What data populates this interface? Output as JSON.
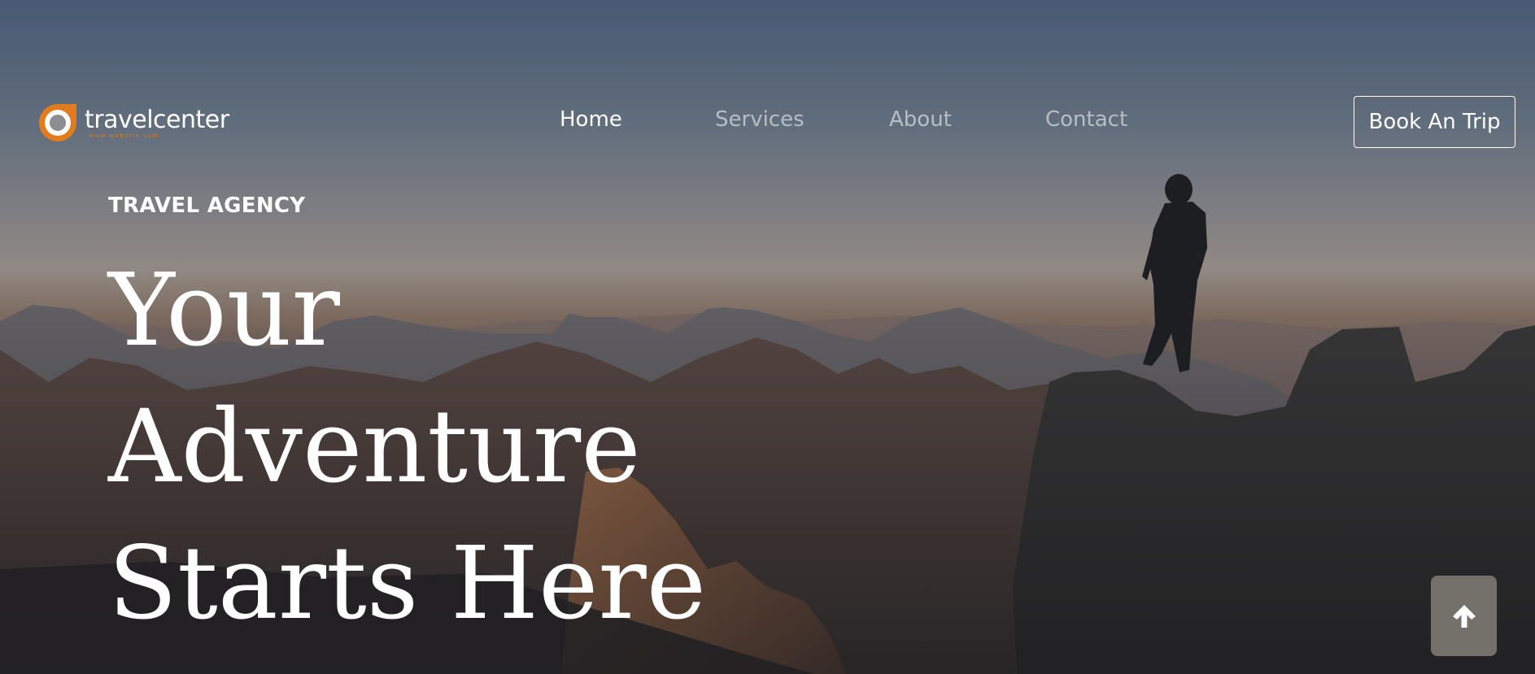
{
  "brand": {
    "name": "travelcenter",
    "tagline": "www.website.com",
    "logo_icon": "travelcenter-logo-icon",
    "accent_color": "#e27a1e"
  },
  "nav": {
    "items": [
      {
        "label": "Home",
        "active": true
      },
      {
        "label": "Services",
        "active": false
      },
      {
        "label": "About",
        "active": false
      },
      {
        "label": "Contact",
        "active": false
      }
    ],
    "cta_label": "Book An Trip"
  },
  "hero": {
    "eyebrow": "TRAVEL AGENCY",
    "headline_lines": [
      "Your",
      "Adventure",
      "Starts Here"
    ],
    "background": "mountain-hiker-photo"
  },
  "back_to_top": {
    "icon": "arrow-up-icon",
    "color": "#74716b"
  }
}
